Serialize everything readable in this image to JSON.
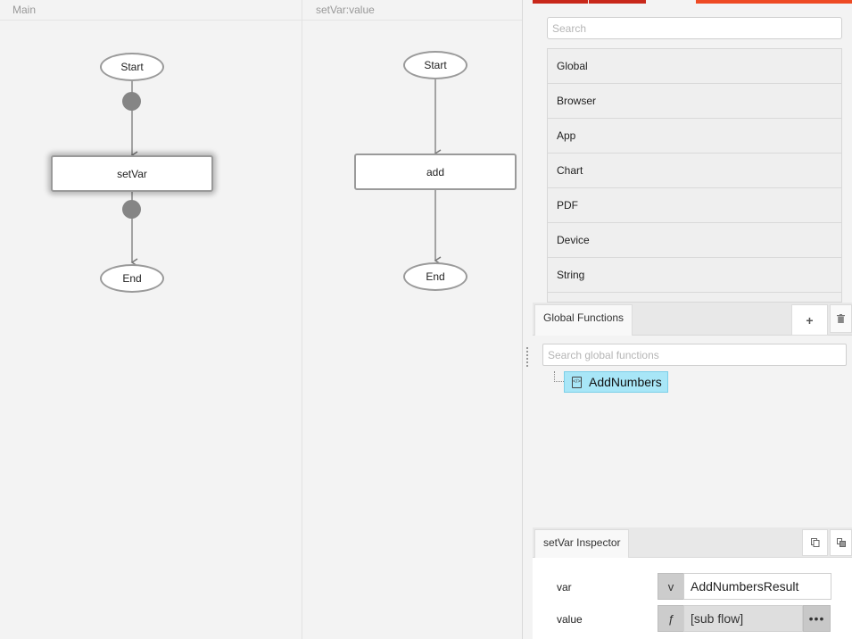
{
  "canvas": {
    "main": {
      "title": "Main",
      "nodes": {
        "start": "Start",
        "setvar": "setVar",
        "end": "End"
      }
    },
    "sub": {
      "title": "setVar:value",
      "nodes": {
        "start": "Start",
        "add": "add",
        "end": "End"
      }
    }
  },
  "toolbox": {
    "search_placeholder": "Search",
    "categories": [
      "Global",
      "Browser",
      "App",
      "Chart",
      "PDF",
      "Device",
      "String"
    ]
  },
  "global_functions": {
    "tab_label": "Global Functions",
    "add_label": "+",
    "delete_icon": "trash-icon",
    "search_placeholder": "Search global functions",
    "items": [
      "AddNumbers"
    ]
  },
  "inspector": {
    "tab_label": "setVar Inspector",
    "copy_icon": "copy-icon",
    "paste_icon": "paste-icon",
    "rows": {
      "var": {
        "label": "var",
        "prefix": "v",
        "value": "AddNumbersResult"
      },
      "value": {
        "label": "value",
        "prefix": "ƒ",
        "value": "[sub flow]",
        "more": "•••"
      }
    }
  },
  "colors": {
    "accent_dark_red": "#c8281a",
    "accent_orange": "#ee4a24",
    "selection": "#a8e6f7"
  }
}
